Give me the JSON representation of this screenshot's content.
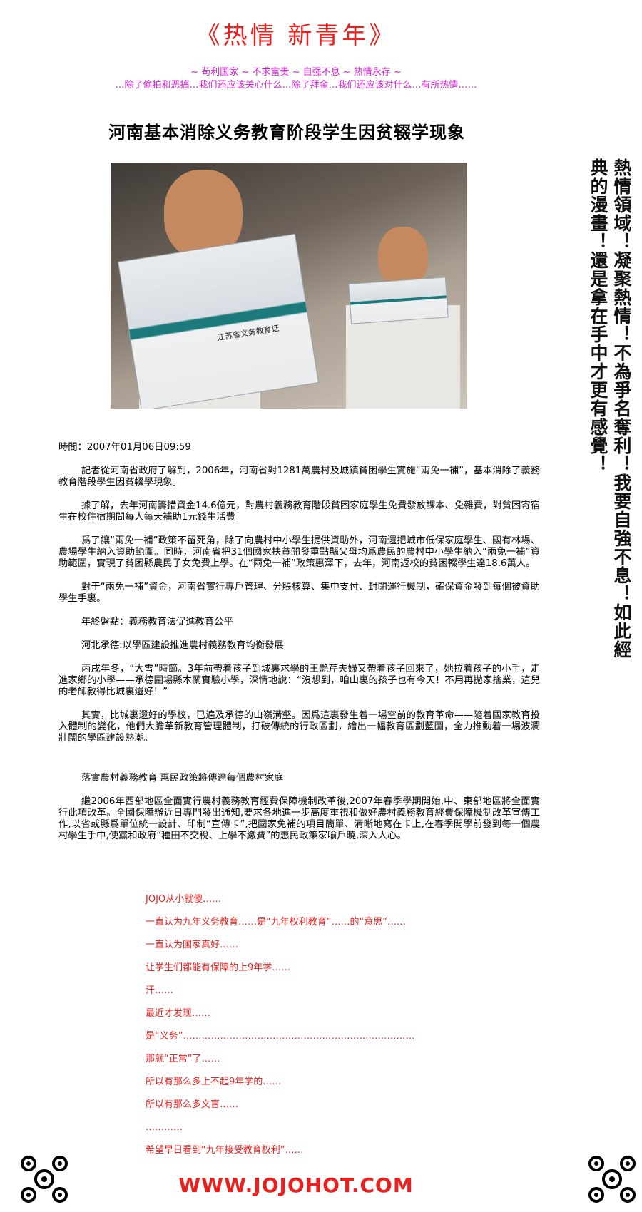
{
  "header": {
    "title": "《热情 新青年》",
    "tagline": "~ 苟利国家 ~ 不求富贵 ~ 自强不息 ~ 热情永存 ~",
    "subtagline": "…除了偷拍和恶搞…我们还应该关心什么…除了拜金…我们还应该对什么…有所热情……"
  },
  "headline": "河南基本消除义务教育阶段学生因贫辍学现象",
  "photo": {
    "card_text": "江苏省义务教育证"
  },
  "sidebar_slogan": "熱情領域！凝聚熱情！不為爭名奪利！我要自強不息！如此經典的漫畫！還是拿在手中才更有感覺！",
  "article": {
    "time": "時間：2007年01月06日09:59",
    "paragraphs": [
      "記者從河南省政府了解到，2006年，河南省對1281萬農村及城鎮貧困學生實施“兩免一補”，基本消除了義務教育階段學生因貧輟學現象。",
      "據了解，去年河南籌措資金14.6億元，對農村義務教育階段貧困家庭學生免費發放課本、免雜費，對貧困寄宿生在校住宿期間每人每天補助1元錢生活費",
      "爲了讓“兩免一補”政策不留死角，除了向農村中小學生提供資助外，河南還把城市低保家庭學生、國有林場、農場學生納入資助範圍。同時，河南省把31個國家扶貧開發重點縣父母均爲農民的農村中小學生納入“兩免一補”資助範圍，實現了貧困縣農民子女免費上學。在“兩免一補”政策惠澤下，去年，河南返校的貧困輟學生達18.6萬人。",
      "對于“兩免一補”資金，河南省實行專戶管理、分賬核算、集中支付、封閉運行機制，確保資金發到每個被資助學生手裏。",
      "年終盤點：義務教育法促進教育公平",
      "河北承德:以學區建設推進農村義務教育均衡發展",
      "丙戌年冬，“大雪”時節。3年前帶着孩子到城裏求學的王艷芹夫婦又帶着孩子回來了，她拉着孩子的小手，走進家鄉的小學——承德圍場縣木蘭實驗小學，深情地說：“沒想到，咱山裏的孩子也有今天！不用再拋家捨業，這兒的老師教得比城裏還好！”",
      "其實，比城裏還好的學校，已遍及承德的山嶺溝壑。因爲這裏發生着一場空前的教育革命——隨着國家教育投入體制的變化，他們大膽革新教育管理體制，打破傳統的行政區劃，繪出一幅教育區劃藍圖，全力推動着一場波瀾壯闊的學區建設熱潮。",
      "落實農村義務教育 惠民政策將傳達每個農村家庭",
      "繼2006年西部地區全面實行農村義務教育經費保障機制改革後,2007年春季學期開始,中、東部地區將全面實行此項改革。全國保障辦近日專門發出通知,要求各地進一步高度重視和做好農村義務教育經費保障機制改革宣傳工作,以省或縣爲單位統一設計、印制“宣傳卡”,把國家免補的項目簡單、清晰地寫在卡上,在春季開學前發到每一個農村學生手中,使黨和政府“種田不交稅、上學不繳費”的惠民政策家喻戶曉,深入人心。"
    ]
  },
  "comment_lines": [
    "JOJO从小就傻……",
    "一直认为九年义务教育……是“九年权利教育”……的“意思”……",
    "一直认为国家真好……",
    "让学生们都能有保障的上9年学……",
    "汗……",
    "最近才发现……",
    "是“义务”…………………………………………………………………",
    "那就“正常”了……",
    "所以有那么多上不起9年学的……",
    "所以有那么多文盲……",
    "…………",
    "希望早日看到“九年接受教育权利”……"
  ],
  "footer": {
    "url": "WWW.JOJOHOT.COM"
  },
  "colors": {
    "accent_red": "#e8211f",
    "magenta": "#d21ed2"
  }
}
